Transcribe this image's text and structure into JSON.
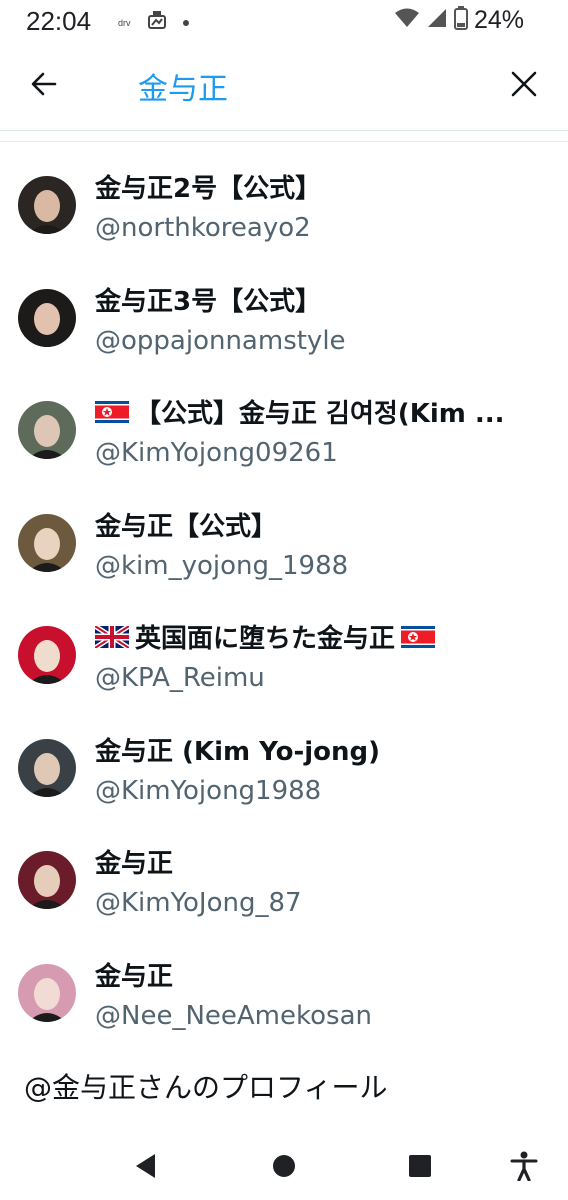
{
  "status_bar": {
    "time": "22:04",
    "app_icon_label": "drv",
    "battery": "24%"
  },
  "header": {
    "search_query": "金与正",
    "back_icon": "arrow-left-icon",
    "clear_icon": "close-icon"
  },
  "results": [
    {
      "name": "金与正2号【公式】",
      "handle": "@northkoreayo2",
      "prefix_flag": "",
      "suffix_flag": "",
      "avatar_colors": [
        "#2b2623",
        "#d9b9a4"
      ]
    },
    {
      "name": "金与正3号【公式】",
      "handle": "@oppajonnamstyle",
      "prefix_flag": "",
      "suffix_flag": "",
      "avatar_colors": [
        "#1d1b1a",
        "#e2c2ae"
      ]
    },
    {
      "name": "【公式】金与正 김여정(Kim ...",
      "handle": "@KimYojong09261",
      "prefix_flag": "north-korea-flag",
      "suffix_flag": "",
      "avatar_colors": [
        "#5e6a5a",
        "#ddc6b6"
      ]
    },
    {
      "name": "金与正【公式】",
      "handle": "@kim_yojong_1988",
      "prefix_flag": "",
      "suffix_flag": "",
      "avatar_colors": [
        "#6d5a3e",
        "#e9d2bf"
      ]
    },
    {
      "name": "英国面に堕ちた金与正",
      "handle": "@KPA_Reimu",
      "prefix_flag": "uk-flag",
      "suffix_flag": "north-korea-flag",
      "avatar_colors": [
        "#c8102e",
        "#f0dccc"
      ]
    },
    {
      "name": "金与正 (Kim Yo-jong)",
      "handle": "@KimYojong1988",
      "prefix_flag": "",
      "suffix_flag": "",
      "avatar_colors": [
        "#3a4146",
        "#e0c8b7"
      ]
    },
    {
      "name": "金与正",
      "handle": "@KimYoJong_87",
      "prefix_flag": "",
      "suffix_flag": "",
      "avatar_colors": [
        "#6b1c2a",
        "#e6cdbb"
      ]
    },
    {
      "name": "金与正",
      "handle": "@Nee_NeeAmekosan",
      "prefix_flag": "",
      "suffix_flag": "",
      "avatar_colors": [
        "#d69bb0",
        "#f2dbd5"
      ]
    }
  ],
  "profile_link": "@金与正さんのプロフィール",
  "nav": {
    "back_icon": "triangle-back-icon",
    "home_icon": "circle-home-icon",
    "recents_icon": "square-recents-icon",
    "accessibility_icon": "accessibility-icon"
  },
  "colors": {
    "accent": "#1d9bf0",
    "text_primary": "#0f1419",
    "text_secondary": "#536471"
  }
}
